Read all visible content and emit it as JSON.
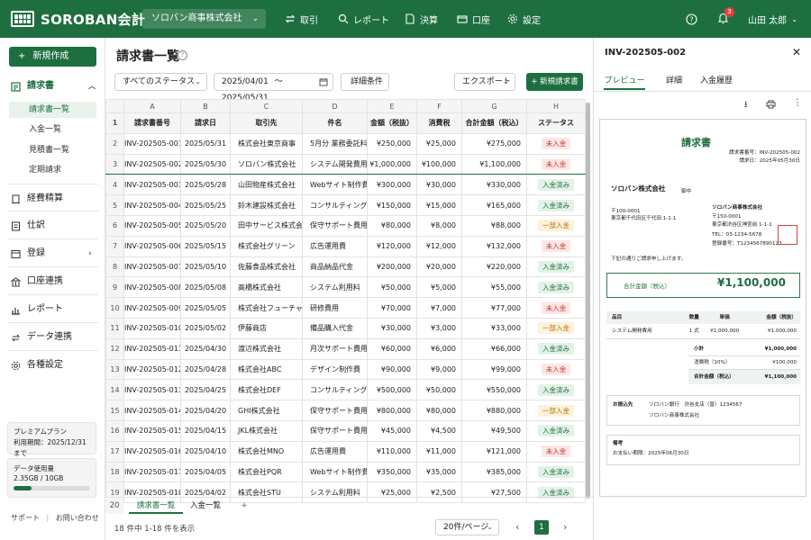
{
  "app": {
    "name": "SOROBAN会計",
    "company": "ソロバン商事株式会社",
    "user": "山田 太郎",
    "notifications": "3",
    "nav": [
      "取引",
      "レポート",
      "決算",
      "口座",
      "設定"
    ]
  },
  "sidebar": {
    "new": "新規作成",
    "invoice": "請求書",
    "subs": [
      "請求書一覧",
      "入金一覧",
      "見積書一覧",
      "定期請求"
    ],
    "items": [
      "経費精算",
      "仕訳",
      "登録",
      "口座連携",
      "レポート",
      "データ連携",
      "各種設定"
    ],
    "plan_title": "プレミアムプラン",
    "plan_period": "利用期間：2025/12/31まで",
    "usage_title": "データ使用量",
    "usage_value": "2.35GB / 10GB",
    "usage_fraction": 0.235,
    "support": "サポート",
    "contact": "お問い合わせ"
  },
  "main": {
    "title": "請求書一覧",
    "status_filter": "すべてのステータス",
    "date_from": "2025/04/01",
    "tilde": "〜",
    "date_to": "2025/05/31",
    "detail": "詳細条件",
    "export": "エクスポート",
    "new_invoice": "新規請求書",
    "col_letters": [
      "A",
      "B",
      "C",
      "D",
      "E",
      "F",
      "G",
      "H"
    ],
    "headers": [
      "請求書番号",
      "請求日",
      "取引先",
      "件名",
      "金額（税抜）",
      "消費税",
      "合計金額（税込）",
      "ステータス"
    ],
    "rows": [
      [
        "INV-202505-001",
        "2025/05/31",
        "株式会社東京商事",
        "5月分 業務委託料",
        "¥250,000",
        "¥25,000",
        "¥275,000",
        "未入金"
      ],
      [
        "INV-202505-002",
        "2025/05/30",
        "ソロバン株式会社",
        "システム開発費用",
        "¥1,000,000",
        "¥100,000",
        "¥1,100,000",
        "未入金"
      ],
      [
        "INV-202505-003",
        "2025/05/28",
        "山田物産株式会社",
        "Webサイト制作費",
        "¥300,000",
        "¥30,000",
        "¥330,000",
        "入金済み"
      ],
      [
        "INV-202505-004",
        "2025/05/25",
        "鈴木建設株式会社",
        "コンサルティング料",
        "¥150,000",
        "¥15,000",
        "¥165,000",
        "入金済み"
      ],
      [
        "INV-202505-005",
        "2025/05/20",
        "田中サービス株式会社",
        "保守サポート費用",
        "¥80,000",
        "¥8,000",
        "¥88,000",
        "一部入金"
      ],
      [
        "INV-202505-006",
        "2025/05/15",
        "株式会社グリーン",
        "広告運用費",
        "¥120,000",
        "¥12,000",
        "¥132,000",
        "未入金"
      ],
      [
        "INV-202505-007",
        "2025/05/10",
        "佐藤食品株式会社",
        "商品納品代金",
        "¥200,000",
        "¥20,000",
        "¥220,000",
        "入金済み"
      ],
      [
        "INV-202505-008",
        "2025/05/08",
        "高橋株式会社",
        "システム利用料",
        "¥50,000",
        "¥5,000",
        "¥55,000",
        "入金済み"
      ],
      [
        "INV-202505-009",
        "2025/05/05",
        "株式会社フューチャー",
        "研修費用",
        "¥70,000",
        "¥7,000",
        "¥77,000",
        "未入金"
      ],
      [
        "INV-202505-010",
        "2025/05/02",
        "伊藤商店",
        "備品購入代金",
        "¥30,000",
        "¥3,000",
        "¥33,000",
        "一部入金"
      ],
      [
        "INV-202505-011",
        "2025/04/30",
        "渡辺株式会社",
        "月次サポート費用",
        "¥60,000",
        "¥6,000",
        "¥66,000",
        "入金済み"
      ],
      [
        "INV-202505-012",
        "2025/04/28",
        "株式会社ABC",
        "デザイン制作費",
        "¥90,000",
        "¥9,000",
        "¥99,000",
        "未入金"
      ],
      [
        "INV-202505-013",
        "2025/04/25",
        "株式会社DEF",
        "コンサルティング料",
        "¥500,000",
        "¥50,000",
        "¥550,000",
        "入金済み"
      ],
      [
        "INV-202505-014",
        "2025/04/20",
        "GHI株式会社",
        "保守サポート費用",
        "¥800,000",
        "¥80,000",
        "¥880,000",
        "一部入金"
      ],
      [
        "INV-202505-015",
        "2025/04/15",
        "JKL株式会社",
        "保守サポート費用",
        "¥45,000",
        "¥4,500",
        "¥49,500",
        "入金済み"
      ],
      [
        "INV-202505-016",
        "2025/04/10",
        "株式会社MNO",
        "広告運用費",
        "¥110,000",
        "¥11,000",
        "¥121,000",
        "未入金"
      ],
      [
        "INV-202505-017",
        "2025/04/05",
        "株式会社PQR",
        "Webサイト制作費",
        "¥350,000",
        "¥35,000",
        "¥385,000",
        "入金済み"
      ],
      [
        "INV-202505-018",
        "2025/04/02",
        "株式会社STU",
        "システム利用料",
        "¥25,000",
        "¥2,500",
        "¥27,500",
        "入金済み"
      ]
    ],
    "row_numbers": [
      "1",
      "2",
      "3",
      "4",
      "5",
      "6",
      "7",
      "8",
      "9",
      "10",
      "11",
      "12",
      "13",
      "14",
      "15",
      "16",
      "17",
      "18",
      "19",
      "20"
    ],
    "sheet_tab1": "請求書一覧",
    "sheet_tab2": "入金一覧",
    "plus": "+",
    "count": "18 件中 1-18 件を表示",
    "per_page": "20件/ページ",
    "page": "1"
  },
  "preview": {
    "id": "INV-202505-002",
    "tabs": [
      "プレビュー",
      "詳細",
      "入金履歴"
    ],
    "doc": {
      "title": "請求書",
      "no": "請求書番号：INV-202505-002",
      "date": "請求日：2025年05月30日",
      "to": "ソロバン株式会社",
      "onchu": "御中",
      "to_zip": "〒100-0001",
      "to_addr": "東京都千代田区千代田 1-1-1",
      "from": "ソロバン商事株式会社",
      "from_zip": "〒150-0001",
      "from_addr": "東京都渋谷区神宮前 1-1-1",
      "tel": "TEL：03-1234-5678",
      "reg": "登録番号：T1234567890123",
      "seal": "ソロバン商事株式会社印",
      "lead": "下記の通りご請求申し上げます。",
      "total_label": "合計金額（税込）",
      "total": "¥1,100,000",
      "th": [
        "品目",
        "数量",
        "単価",
        "金額（税抜）"
      ],
      "item": [
        "システム開発費用",
        "1 式",
        "¥1,000,000",
        "¥1,000,000"
      ],
      "subtotal_l": "小計",
      "subtotal": "¥1,000,000",
      "tax_l": "消費税（10%）",
      "tax": "¥100,000",
      "sum_l": "合計金額（税込）",
      "sum": "¥1,100,000",
      "bank_l": "お振込先",
      "bank1": "ソロバン銀行　渋谷支店（普）1234567",
      "bank2": "ソロバン商事株式会社",
      "note_l": "備考",
      "note": "お支払い期限：2025年06月30日"
    }
  },
  "colors": {
    "brand": "#1e6f40",
    "unpaid": "#c0392b",
    "paid": "#1e6f40",
    "partial": "#b77400"
  }
}
